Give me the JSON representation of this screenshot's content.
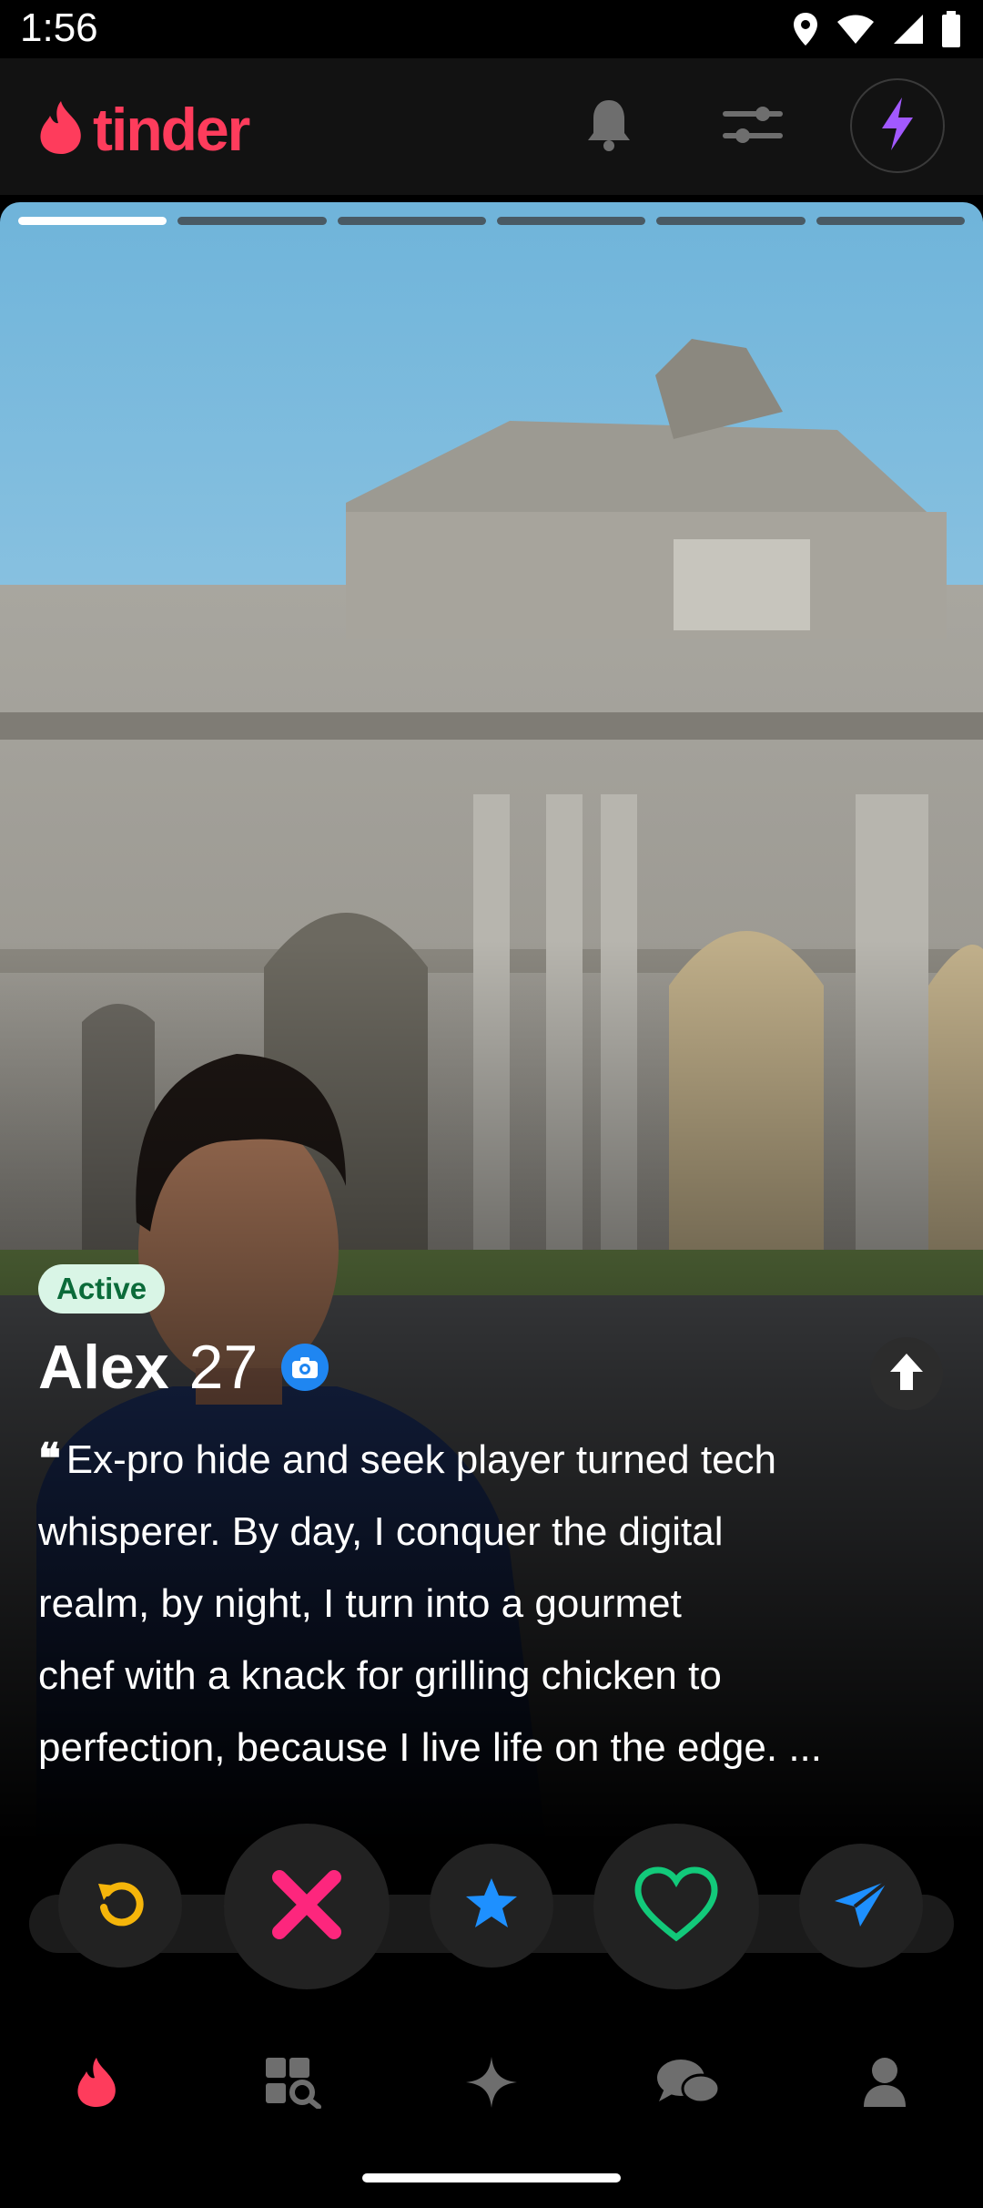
{
  "status_bar": {
    "time": "1:56"
  },
  "header": {
    "logo_text": "tinder"
  },
  "profile": {
    "photo_count": 6,
    "active_photo": 1,
    "badge": "Active",
    "name": "Alex",
    "age": "27",
    "bio_lines": [
      "Ex-pro hide and seek player turned tech",
      "whisperer. By day, I conquer the digital",
      "realm, by night, I turn into a gourmet",
      "chef with a knack for grilling chicken to",
      "perfection, because I live life on the edge. ..."
    ]
  },
  "colors": {
    "brand": "#fe3c5c",
    "rewind": "#f5b50a",
    "nope": "#fd267d",
    "super_like": "#1e90ff",
    "like": "#12c97a",
    "boost": "#a259ff",
    "verified": "#1f86f1"
  },
  "icons": {
    "header": [
      "notification-bell-icon",
      "filter-sliders-icon",
      "boost-lightning-icon"
    ],
    "actions": [
      "rewind-icon",
      "nope-icon",
      "super-like-icon",
      "like-icon",
      "super-boost-icon"
    ],
    "tabs": [
      "flame-icon",
      "explore-icon",
      "sparkle-icon",
      "chat-icon",
      "profile-icon"
    ]
  }
}
